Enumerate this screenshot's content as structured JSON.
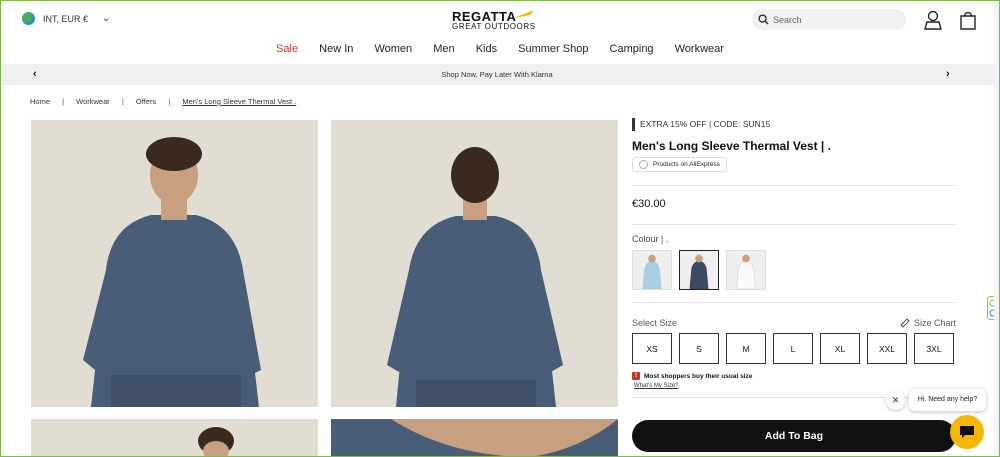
{
  "header": {
    "locale": "INT, EUR €",
    "logo_line1": "REGATTA",
    "logo_line2": "GREAT OUTDOORS",
    "search_placeholder": "Search"
  },
  "nav": {
    "items": [
      "Sale",
      "New In",
      "Women",
      "Men",
      "Kids",
      "Summer Shop",
      "Camping",
      "Workwear"
    ]
  },
  "promo": {
    "text": "Shop Now, Pay Later With Klarna"
  },
  "breadcrumb": {
    "items": [
      "Home",
      "Workwear",
      "Offers",
      "Men's Long Sleeve Thermal Vest ."
    ],
    "separator": "|"
  },
  "product": {
    "badge": "EXTRA 15% OFF | CODE: SUN15",
    "title": "Men's Long Sleeve Thermal Vest | .",
    "aliexpress_label": "Products on AliExpress",
    "price": "€30.00",
    "colour_label": "Colour | .",
    "swatches": [
      {
        "name": "light-blue",
        "color": "#a9cde3"
      },
      {
        "name": "navy",
        "color": "#3a4a63"
      },
      {
        "name": "white",
        "color": "#f2f2f2"
      }
    ],
    "selected_swatch": 1,
    "size_label": "Select Size",
    "size_chart_label": "Size Chart",
    "sizes": [
      "XS",
      "S",
      "M",
      "L",
      "XL",
      "XXL",
      "3XL"
    ],
    "size_note": "Most shoppers buy their usual size",
    "what_size_link": "What's My Size?",
    "add_to_bag": "Add To Bag"
  },
  "chat": {
    "greeting": "Hi. Need any help?",
    "close_symbol": "✕"
  },
  "colors": {
    "accent_yellow": "#f5b700",
    "sale_red": "#c0392b",
    "shirt": "#4a5d78",
    "background_image": "#e2ddd3"
  }
}
